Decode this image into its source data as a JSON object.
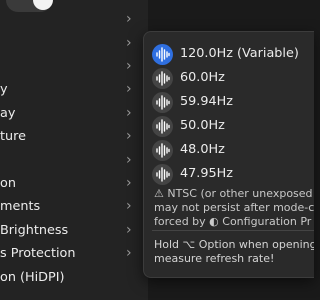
{
  "left_menu": {
    "items": [
      {
        "label": "",
        "has_submenu": true
      },
      {
        "label": "",
        "has_submenu": true
      },
      {
        "label": "",
        "has_submenu": true
      },
      {
        "label": "y",
        "has_submenu": true
      },
      {
        "label": "ay",
        "has_submenu": true
      },
      {
        "label": "ture",
        "has_submenu": true
      },
      {
        "label": "",
        "has_submenu": true
      },
      {
        "label": "on",
        "has_submenu": true
      },
      {
        "label": "ments",
        "has_submenu": true
      },
      {
        "label": "Brightness",
        "has_submenu": true
      },
      {
        "label": "s Protection",
        "has_submenu": true
      },
      {
        "label": "on (HiDPI)",
        "has_submenu": false
      }
    ]
  },
  "refresh_menu": {
    "rates": [
      {
        "label": "120.0Hz (Variable)",
        "selected": true
      },
      {
        "label": "60.0Hz",
        "selected": false
      },
      {
        "label": "59.94Hz",
        "selected": false
      },
      {
        "label": "50.0Hz",
        "selected": false
      },
      {
        "label": "48.0Hz",
        "selected": false
      },
      {
        "label": "47.95Hz",
        "selected": false
      }
    ],
    "warning_lines": [
      "⚠ NTSC (or other unexposed",
      "may not persist after mode-c",
      "forced by ◐ Configuration Pr"
    ],
    "hint_lines": [
      "Hold ⌥ Option when opening",
      "measure refresh rate!"
    ]
  },
  "colors": {
    "selection_accent": "#2f6fe0",
    "menu_background": "#2a2a2a"
  },
  "icons": {
    "rate_icon": "waveform-icon",
    "submenu_arrow": "chevron-right-icon"
  }
}
